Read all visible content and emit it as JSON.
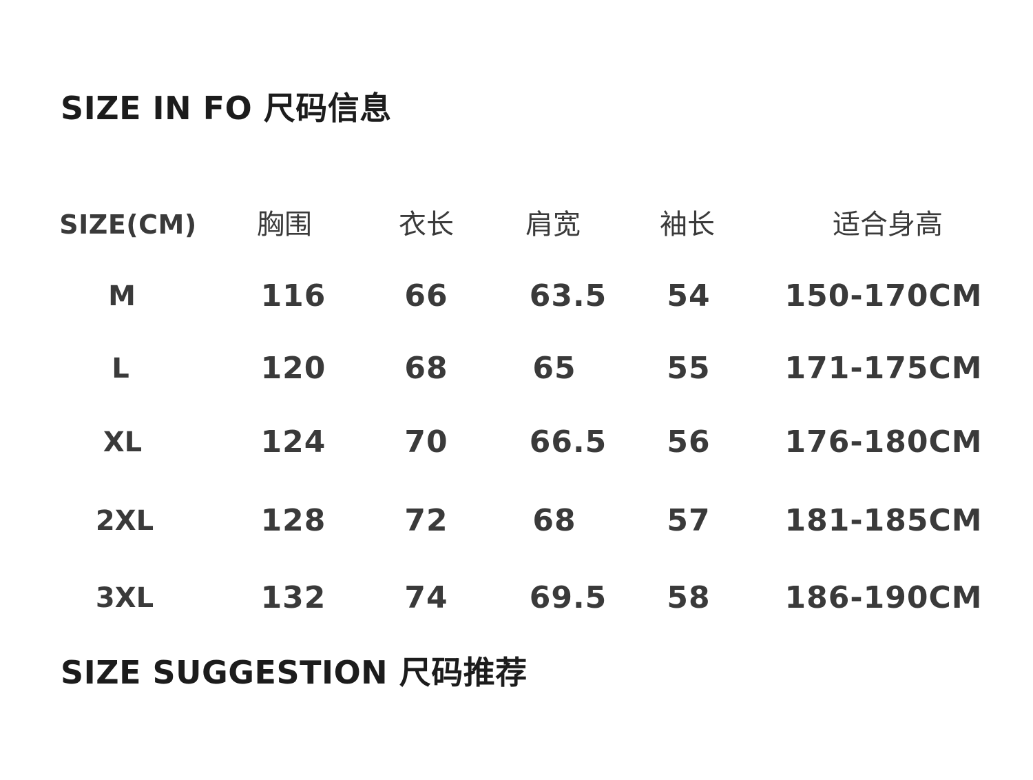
{
  "info_title": "SIZE IN FO 尺码信息",
  "suggestion_title": "SIZE SUGGESTION  尺码推荐",
  "table": {
    "headers": [
      "SIZE(CM)",
      "胸围",
      "衣长",
      "肩宽",
      "袖长",
      "适合身高"
    ],
    "rows": [
      [
        "M",
        "116",
        "66",
        "63.5",
        "54",
        "150-170CM"
      ],
      [
        "L",
        "120",
        "68",
        "65",
        "55",
        "171-175CM"
      ],
      [
        "XL",
        "124",
        "70",
        "66.5",
        "56",
        "176-180CM"
      ],
      [
        "2XL",
        "128",
        "72",
        "68",
        "57",
        "181-185CM"
      ],
      [
        "3XL",
        "132",
        "74",
        "69.5",
        "58",
        "186-190CM"
      ]
    ]
  }
}
